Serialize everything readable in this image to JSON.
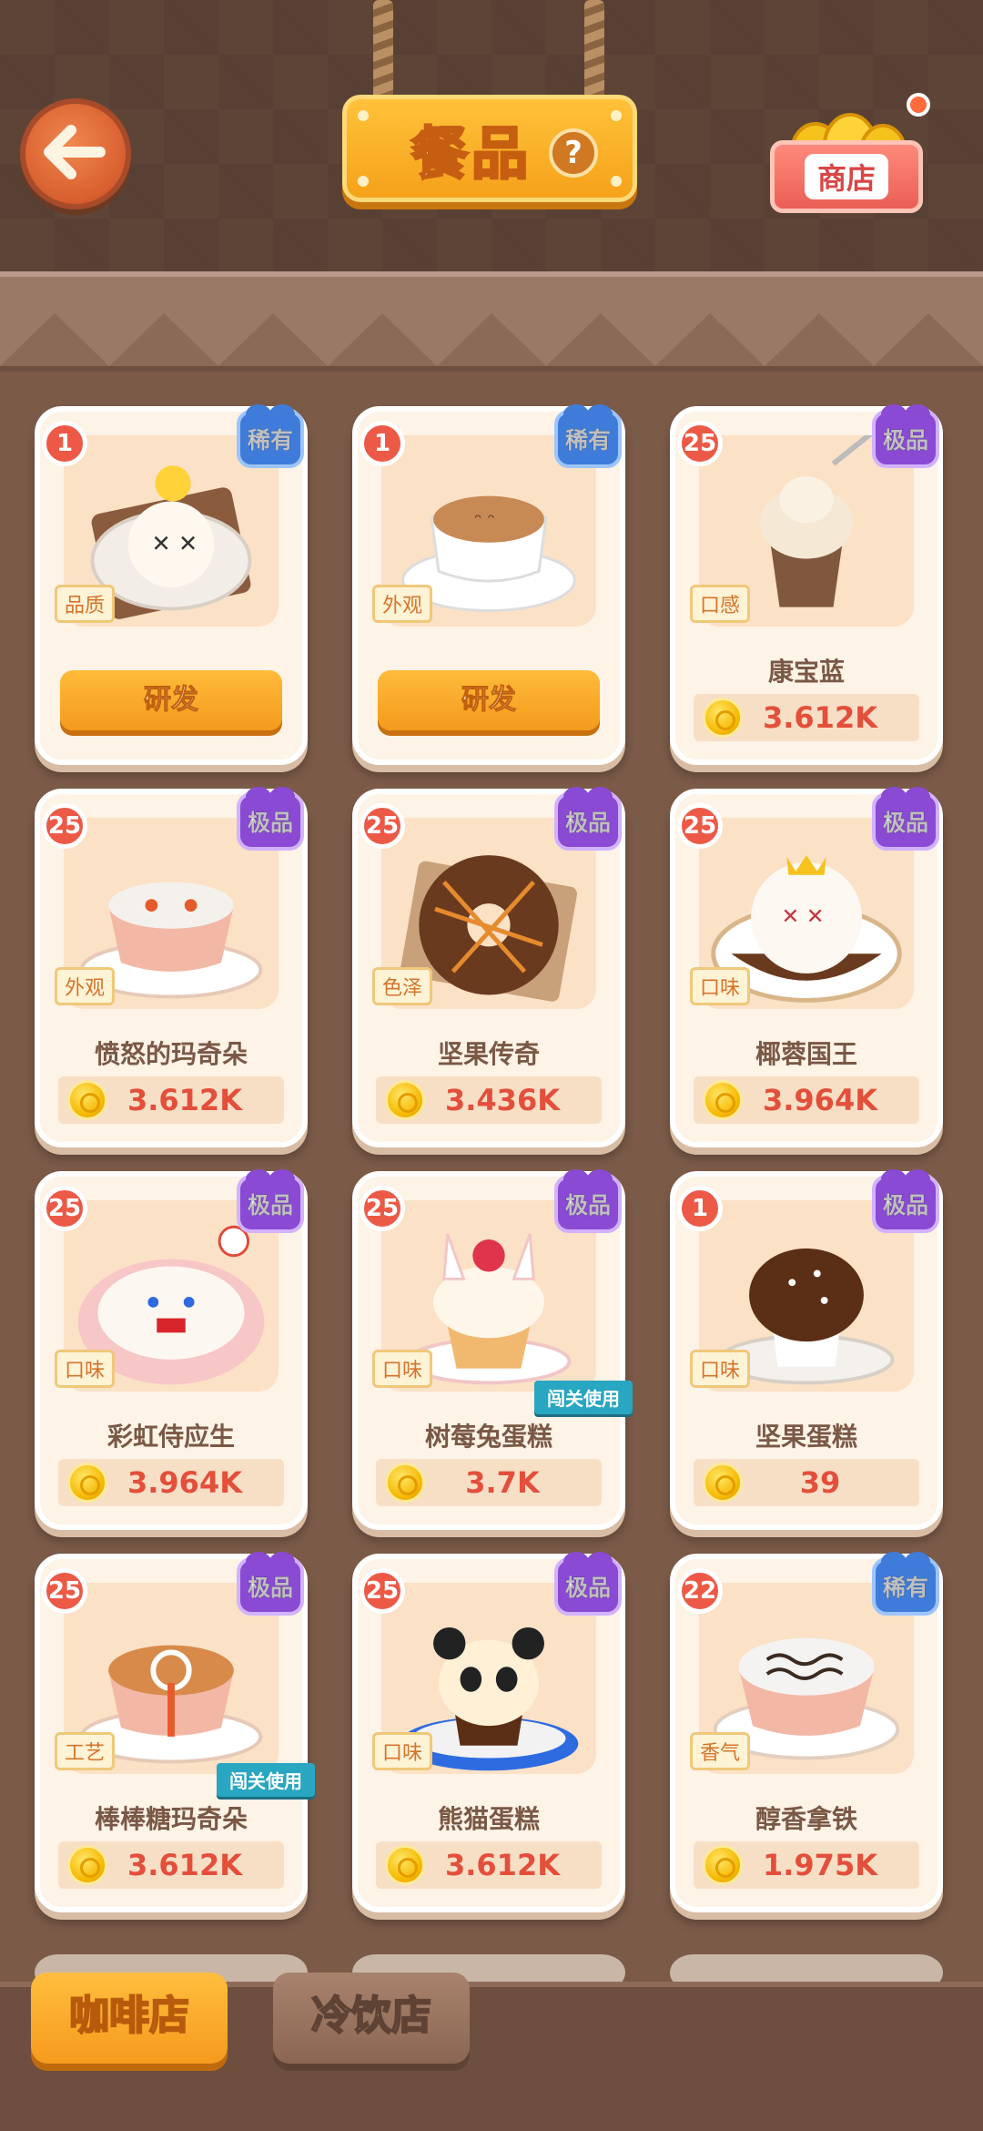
{
  "header": {
    "title": "餐品",
    "help_symbol": "?",
    "shop_label": "商店"
  },
  "colors": {
    "rare": "#3f7cd9",
    "epic": "#8a4ad4",
    "price": "#e34f3b",
    "accent": "#f5a21a"
  },
  "items": [
    {
      "level": "1",
      "rarity": "稀有",
      "rarity_type": "rare",
      "attribute": "品质",
      "action": "研发",
      "food": "donut-chick-icon"
    },
    {
      "level": "1",
      "rarity": "稀有",
      "rarity_type": "rare",
      "attribute": "外观",
      "action": "研发",
      "food": "cat-latte-icon"
    },
    {
      "level": "25",
      "rarity": "极品",
      "rarity_type": "epic",
      "attribute": "口感",
      "name": "康宝蓝",
      "price": "3.612K",
      "food": "con-panna-icon"
    },
    {
      "level": "25",
      "rarity": "极品",
      "rarity_type": "epic",
      "attribute": "外观",
      "name": "愤怒的玛奇朵",
      "price": "3.612K",
      "food": "angry-macchiato-icon"
    },
    {
      "level": "25",
      "rarity": "极品",
      "rarity_type": "epic",
      "attribute": "色泽",
      "name": "坚果传奇",
      "price": "3.436K",
      "food": "nut-donut-icon"
    },
    {
      "level": "25",
      "rarity": "极品",
      "rarity_type": "epic",
      "attribute": "口味",
      "name": "椰蓉国王",
      "price": "3.964K",
      "food": "coconut-king-icon"
    },
    {
      "level": "25",
      "rarity": "极品",
      "rarity_type": "epic",
      "attribute": "口味",
      "name": "彩虹侍应生",
      "price": "3.964K",
      "food": "rainbow-waiter-icon"
    },
    {
      "level": "25",
      "rarity": "极品",
      "rarity_type": "epic",
      "attribute": "口味",
      "name": "树莓兔蛋糕",
      "price": "3.7K",
      "event": "闯关使用",
      "food": "raspberry-bunny-cake-icon"
    },
    {
      "level": "1",
      "rarity": "极品",
      "rarity_type": "epic",
      "attribute": "口味",
      "name": "坚果蛋糕",
      "price": "39",
      "food": "nut-muffin-icon"
    },
    {
      "level": "25",
      "rarity": "极品",
      "rarity_type": "epic",
      "attribute": "工艺",
      "name": "棒棒糖玛奇朵",
      "price": "3.612K",
      "event": "闯关使用",
      "food": "lollipop-macchiato-icon"
    },
    {
      "level": "25",
      "rarity": "极品",
      "rarity_type": "epic",
      "attribute": "口味",
      "name": "熊猫蛋糕",
      "price": "3.612K",
      "food": "panda-cake-icon"
    },
    {
      "level": "22",
      "rarity": "稀有",
      "rarity_type": "rare",
      "attribute": "香气",
      "name": "醇香拿铁",
      "price": "1.975K",
      "food": "mellow-latte-icon"
    }
  ],
  "tabs": [
    {
      "label": "咖啡店",
      "active": true
    },
    {
      "label": "冷饮店",
      "active": false
    }
  ]
}
